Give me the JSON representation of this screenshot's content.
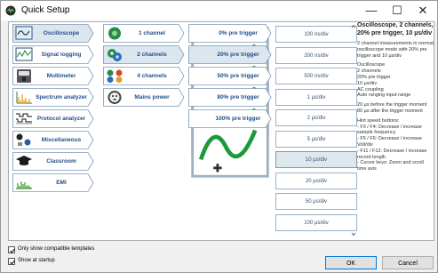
{
  "window": {
    "title": "Quick Setup",
    "minimize": "—",
    "maximize": "☐",
    "close": "✕"
  },
  "categories": [
    {
      "label": "Oscilloscope",
      "icon": "oscilloscope-icon",
      "selected": true
    },
    {
      "label": "Signal logging",
      "icon": "signal-logging-icon",
      "selected": false
    },
    {
      "label": "Multimeter",
      "icon": "multimeter-icon",
      "selected": false
    },
    {
      "label": "Spectrum analyzer",
      "icon": "spectrum-analyzer-icon",
      "selected": false
    },
    {
      "label": "Protocol analyzer",
      "icon": "protocol-analyzer-icon",
      "selected": false
    },
    {
      "label": "Miscellaneous",
      "icon": "miscellaneous-icon",
      "selected": false
    },
    {
      "label": "Classroom",
      "icon": "classroom-icon",
      "selected": false
    },
    {
      "label": "EMI",
      "icon": "emi-icon",
      "selected": false
    }
  ],
  "channels": [
    {
      "label": "1 channel",
      "icon": "one-channel-icon",
      "selected": false
    },
    {
      "label": "2 channels",
      "icon": "two-channels-icon",
      "selected": true
    },
    {
      "label": "4 channels",
      "icon": "four-channels-icon",
      "selected": false
    },
    {
      "label": "Mains power",
      "icon": "mains-power-icon",
      "selected": false
    }
  ],
  "triggers": [
    {
      "label": "0% pre trigger",
      "icon": "pre-trigger-icon",
      "selected": false
    },
    {
      "label": "20% pre trigger",
      "icon": "pre-trigger-icon",
      "selected": true
    },
    {
      "label": "50% pre trigger",
      "icon": "pre-trigger-icon",
      "selected": false
    },
    {
      "label": "80% pre trigger",
      "icon": "pre-trigger-icon",
      "selected": false
    },
    {
      "label": "100% pre trigger",
      "icon": "pre-trigger-icon",
      "selected": false
    }
  ],
  "timebases": [
    {
      "label": "100 ns/div",
      "selected": false
    },
    {
      "label": "200 ns/div",
      "selected": false
    },
    {
      "label": "500 ns/div",
      "selected": false
    },
    {
      "label": "1 µs/div",
      "selected": false
    },
    {
      "label": "2 µs/div",
      "selected": false
    },
    {
      "label": "5 µs/div",
      "selected": false
    },
    {
      "label": "10 µs/div",
      "selected": true
    },
    {
      "label": "20 µs/div",
      "selected": false
    },
    {
      "label": "50 µs/div",
      "selected": false
    },
    {
      "label": "100 µs/div",
      "selected": false
    }
  ],
  "description": {
    "title": "Oscilloscope, 2 channels, 20% pre trigger, 10 µs/div",
    "paragraphs": [
      "2 channel measurements in normal oscilloscope mode with 20% pre trigger and 10 µs/div",
      "Oscilloscope\n2 channels\n20% pre trigger\n10 µs/div\nAC coupling\nAuto ranging input range",
      "20 µs before the trigger moment\n80 µs after the trigger moment",
      "Hint speed buttons:\n- F3 / F4: Decrease / increase sample frequency\n- F5 / F6: Decrease / increase Volt/div\n- F11 / F12: Decrease / increase record length\n- Cursor keys: Zoom and scroll time axis"
    ]
  },
  "footer": {
    "only_compatible": "Only show compatible templates",
    "only_compatible_checked": true,
    "show_at_startup": "Show at startup",
    "show_at_startup_checked": true,
    "ok": "OK",
    "cancel": "Cancel"
  },
  "colors": {
    "tile_label": "#1f4f8a",
    "tile_border": "#7d99b6",
    "selected_fill": "#dbe6ee",
    "ok_border": "#0078d7"
  }
}
